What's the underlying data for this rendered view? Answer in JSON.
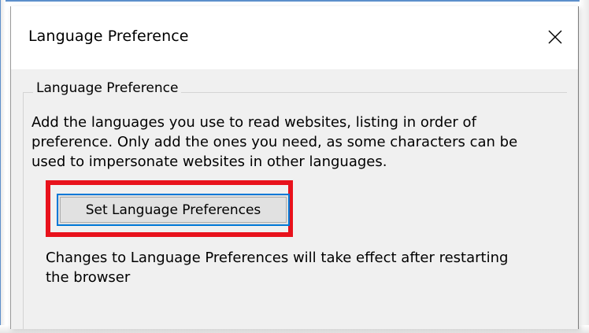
{
  "dialog": {
    "title": "Language Preference",
    "close_label": "Close"
  },
  "group": {
    "legend": "Language Preference",
    "description": "Add the languages you use to read websites, listing in order of preference. Only add the ones you need, as some characters can be used to impersonate websites in other languages.",
    "button_label": "Set Language Preferences",
    "note": "Changes to Language Preferences will take effect after restarting the browser"
  },
  "colors": {
    "highlight": "#e8121c",
    "focus": "#0078d7",
    "window_border": "#5d8fcb"
  },
  "icons": {
    "close": "close-icon"
  }
}
